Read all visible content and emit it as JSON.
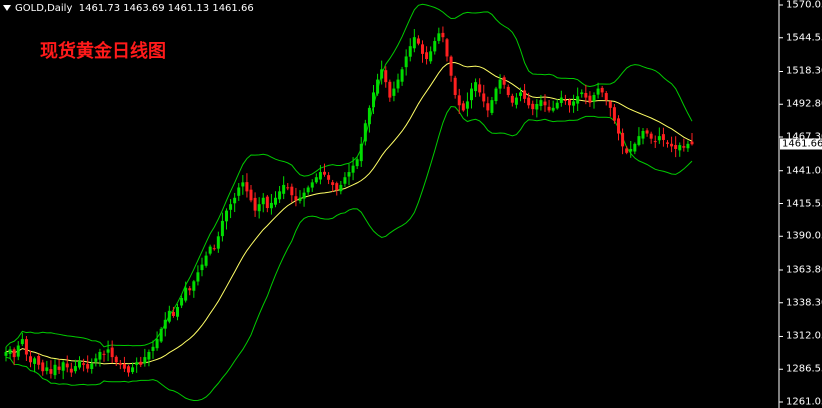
{
  "header": {
    "symbol": "GOLD,Daily",
    "ohlc": "1461.73 1463.69 1461.13 1461.66",
    "title": "现货黄金日线图"
  },
  "axis": {
    "ticks": [
      "1570.05",
      "1544.55",
      "1518.30",
      "1492.80",
      "1467.30",
      "1441.05",
      "1415.55",
      "1390.05",
      "1363.80",
      "1338.30",
      "1312.05",
      "1286.55",
      "1261.05"
    ],
    "current_price": "1461.66"
  },
  "colors": {
    "background": "#000000",
    "bull": "#00dd00",
    "bear": "#ff2020",
    "band": "#00cc00",
    "ma": "#ffff66",
    "text": "#ffffff",
    "title": "#ff1a1a"
  },
  "chart_data": {
    "type": "candlestick",
    "title": "现货黄金日线图",
    "ylim": [
      1261.05,
      1570.05
    ],
    "indicators": [
      "Bollinger Bands",
      "Moving Average"
    ],
    "close": [
      1300,
      1302,
      1296,
      1305,
      1310,
      1298,
      1292,
      1295,
      1290,
      1285,
      1288,
      1283,
      1290,
      1286,
      1292,
      1288,
      1284,
      1289,
      1293,
      1290,
      1287,
      1291,
      1295,
      1300,
      1298,
      1302,
      1296,
      1292,
      1290,
      1287,
      1284,
      1288,
      1292,
      1290,
      1296,
      1300,
      1304,
      1310,
      1318,
      1325,
      1332,
      1328,
      1335,
      1342,
      1350,
      1348,
      1355,
      1362,
      1368,
      1375,
      1382,
      1380,
      1390,
      1402,
      1410,
      1415,
      1420,
      1428,
      1432,
      1425,
      1418,
      1410,
      1415,
      1420,
      1412,
      1416,
      1420,
      1425,
      1430,
      1428,
      1422,
      1418,
      1420,
      1424,
      1428,
      1432,
      1436,
      1440,
      1438,
      1434,
      1430,
      1426,
      1430,
      1436,
      1440,
      1445,
      1450,
      1462,
      1478,
      1490,
      1502,
      1512,
      1520,
      1510,
      1498,
      1505,
      1512,
      1520,
      1530,
      1538,
      1545,
      1540,
      1532,
      1528,
      1534,
      1542,
      1548,
      1545,
      1530,
      1515,
      1500,
      1492,
      1488,
      1495,
      1505,
      1510,
      1502,
      1495,
      1488,
      1496,
      1505,
      1512,
      1508,
      1500,
      1494,
      1498,
      1502,
      1497,
      1492,
      1489,
      1493,
      1496,
      1492,
      1488,
      1490,
      1494,
      1498,
      1496,
      1492,
      1495,
      1499,
      1502,
      1498,
      1494,
      1500,
      1505,
      1502,
      1496,
      1490,
      1480,
      1470,
      1460,
      1455,
      1458,
      1462,
      1468,
      1472,
      1470,
      1466,
      1464,
      1468,
      1465,
      1462,
      1460,
      1458,
      1461,
      1459,
      1462,
      1461.66
    ]
  }
}
